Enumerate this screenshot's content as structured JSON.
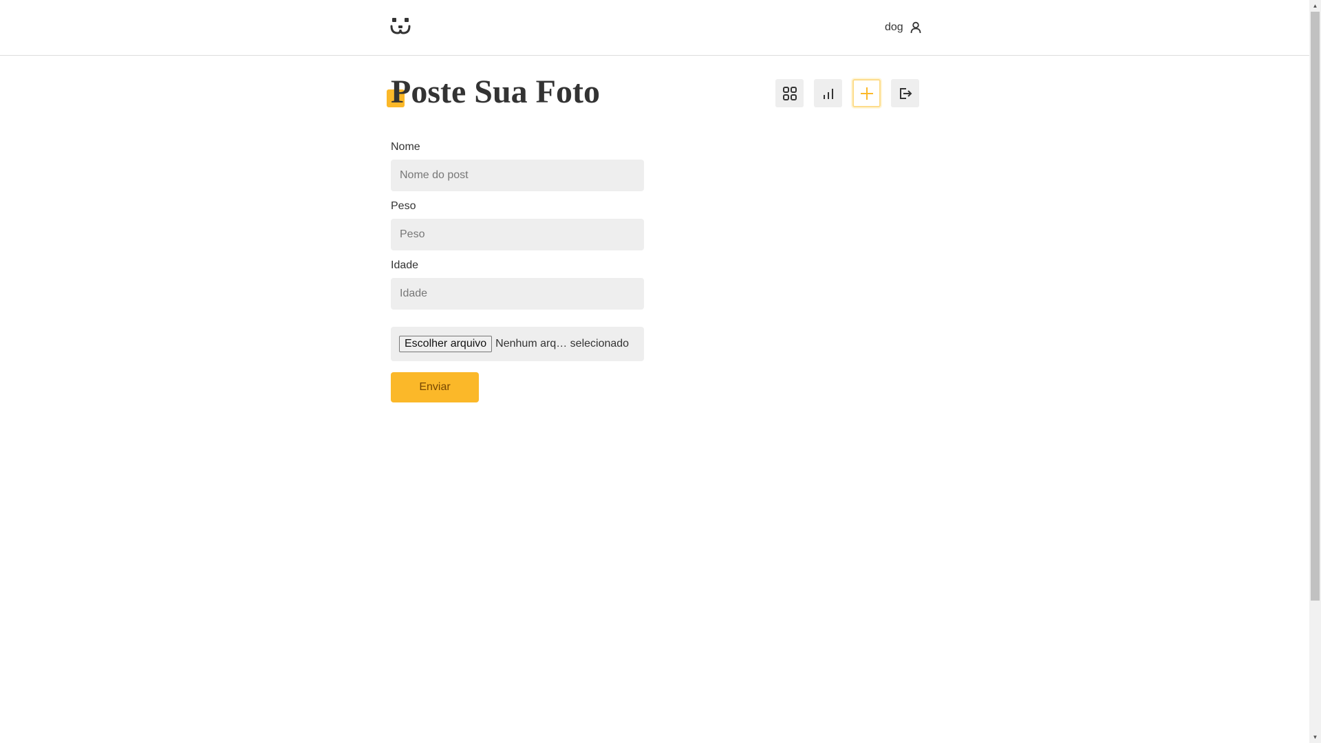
{
  "header": {
    "logo_icon": "dog-face-logo-icon",
    "username": "dog",
    "user_icon": "user-icon"
  },
  "page": {
    "title": "Poste Sua Foto"
  },
  "nav": {
    "items": [
      {
        "icon": "grid-icon",
        "active": false
      },
      {
        "icon": "bar-chart-icon",
        "active": false
      },
      {
        "icon": "plus-icon",
        "active": true
      },
      {
        "icon": "logout-icon",
        "active": false
      }
    ]
  },
  "form": {
    "nome": {
      "label": "Nome",
      "placeholder": "Nome do post",
      "value": ""
    },
    "peso": {
      "label": "Peso",
      "placeholder": "Peso",
      "value": ""
    },
    "idade": {
      "label": "Idade",
      "placeholder": "Idade",
      "value": ""
    },
    "file": {
      "button_label": "Escolher arquivo",
      "status": "Nenhum arq… selecionado"
    },
    "submit_label": "Enviar"
  },
  "colors": {
    "accent": "#fbb829",
    "input_bg": "#eeeeee",
    "text": "#333333",
    "button_text": "#764701"
  }
}
